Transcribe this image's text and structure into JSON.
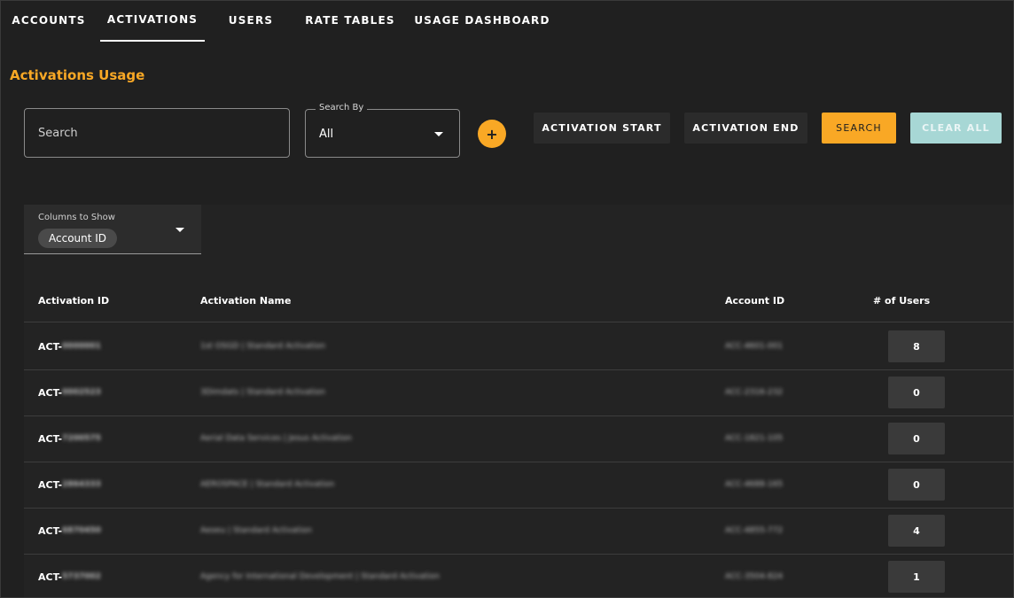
{
  "nav": {
    "tabs": [
      {
        "label": "ACCOUNTS",
        "active": false
      },
      {
        "label": "ACTIVATIONS",
        "active": true
      },
      {
        "label": "USERS",
        "active": false
      },
      {
        "label": "RATE TABLES",
        "active": false
      },
      {
        "label": "USAGE DASHBOARD",
        "active": false
      }
    ]
  },
  "page": {
    "title": "Activations Usage"
  },
  "filters": {
    "search_placeholder": "Search",
    "search_by_label": "Search By",
    "search_by_value": "All",
    "add_icon": "+",
    "activation_start_label": "ACTIVATION START",
    "activation_end_label": "ACTIVATION END",
    "search_button_label": "SEARCH",
    "clear_all_label": "CLEAR ALL"
  },
  "columns_selector": {
    "label": "Columns to Show",
    "chip": "Account ID"
  },
  "table": {
    "headers": [
      "Activation ID",
      "Activation Name",
      "Account ID",
      "# of Users"
    ],
    "rows": [
      {
        "id_prefix": "ACT-",
        "id_rest": "0000001",
        "name": "1st OSGD | Standard Activation",
        "account": "ACC-4601-001",
        "users": "8"
      },
      {
        "id_prefix": "ACT-",
        "id_rest": "0002523",
        "name": "3Dimdats | Standard Activation",
        "account": "ACC-2316-232",
        "users": "0"
      },
      {
        "id_prefix": "ACT-",
        "id_rest": "7200575",
        "name": "Aerial Data Services | Jesus Activation",
        "account": "ACC-1821-105",
        "users": "0"
      },
      {
        "id_prefix": "ACT-",
        "id_rest": "2864333",
        "name": "AEROSPACE | Standard Activation",
        "account": "ACC-4688-165",
        "users": "0"
      },
      {
        "id_prefix": "ACT-",
        "id_rest": "6870450",
        "name": "Aeoeu | Standard Activation",
        "account": "ACC-4855-772",
        "users": "4"
      },
      {
        "id_prefix": "ACT-",
        "id_rest": "5737002",
        "name": "Agency for International Development | Standard Activation",
        "account": "ACC-3504-824",
        "users": "1"
      }
    ]
  },
  "colors": {
    "accent": "#f9a825",
    "clear_all": "#a7d7d5",
    "background": "#202020"
  }
}
